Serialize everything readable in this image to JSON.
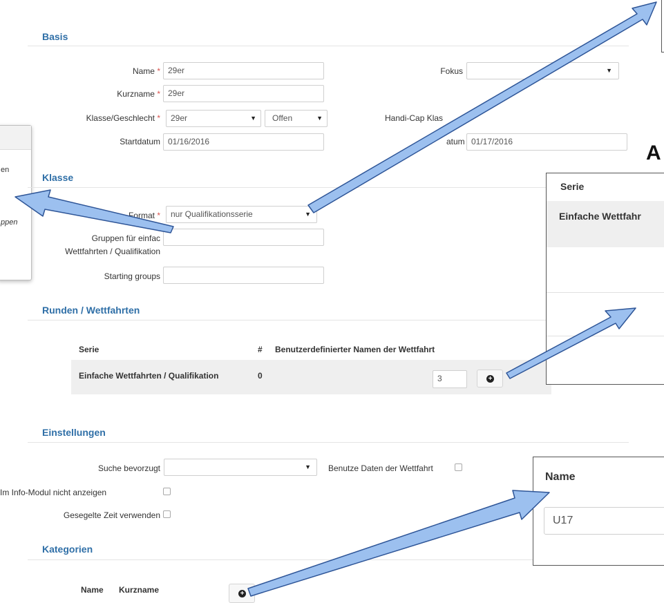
{
  "sections": {
    "basis": "Basis",
    "klasse": "Klasse",
    "runden": "Runden / Wettfahrten",
    "einstellungen": "Einstellungen",
    "kategorien": "Kategorien"
  },
  "basis": {
    "name_label": "Name",
    "name_value": "29er",
    "kurzname_label": "Kurzname",
    "kurzname_value": "29er",
    "klasse_label": "Klasse/Geschlecht",
    "klasse_value": "29er",
    "geschlecht_value": "Offen",
    "startdatum_label": "Startdatum",
    "startdatum_value": "01/16/2016",
    "fokus_label": "Fokus",
    "fokus_value": "",
    "handicap_label": "Handi-Cap Klas",
    "enddatum_label_partial": "atum",
    "enddatum_value": "01/17/2016",
    "required_mark": "*"
  },
  "klasse": {
    "format_label": "Format",
    "format_value": "nur Qualifikationsserie",
    "gruppen_label_1": "Gruppen für einfac",
    "gruppen_label_2": "Wettfahrten / Qualifikation",
    "starting_groups_label": "Starting groups"
  },
  "runden": {
    "col_serie": "Serie",
    "col_hash": "#",
    "col_names": "Benutzerdefinierter Namen der Wettfahrt",
    "row_serie": "Einfache Wettfahrten / Qualifikation",
    "row_count": "0",
    "row_input_value": "3"
  },
  "einstellungen": {
    "suche_label": "Suche bevorzugt",
    "suche_value": "",
    "benutze_label": "Benutze Daten der Wettfahrt",
    "info_label": "Im Info-Modul nicht anzeigen",
    "gesegelt_label": "Gesegelte Zeit verwenden"
  },
  "kategorien": {
    "col_name": "Name",
    "col_kurzname": "Kurzname"
  },
  "left_popup": {
    "text_1": "en",
    "text_2": "ppen"
  },
  "callouts": {
    "big_letter": "A",
    "serie_header": "Serie",
    "serie_row": "Einfache Wettfahr",
    "name_header": "Name",
    "name_value": "U17"
  },
  "colors": {
    "section_title": "#2f6fa7",
    "required": "#d9534f",
    "arrow_fill": "#9cc0ef",
    "arrow_stroke": "#2e5597"
  }
}
